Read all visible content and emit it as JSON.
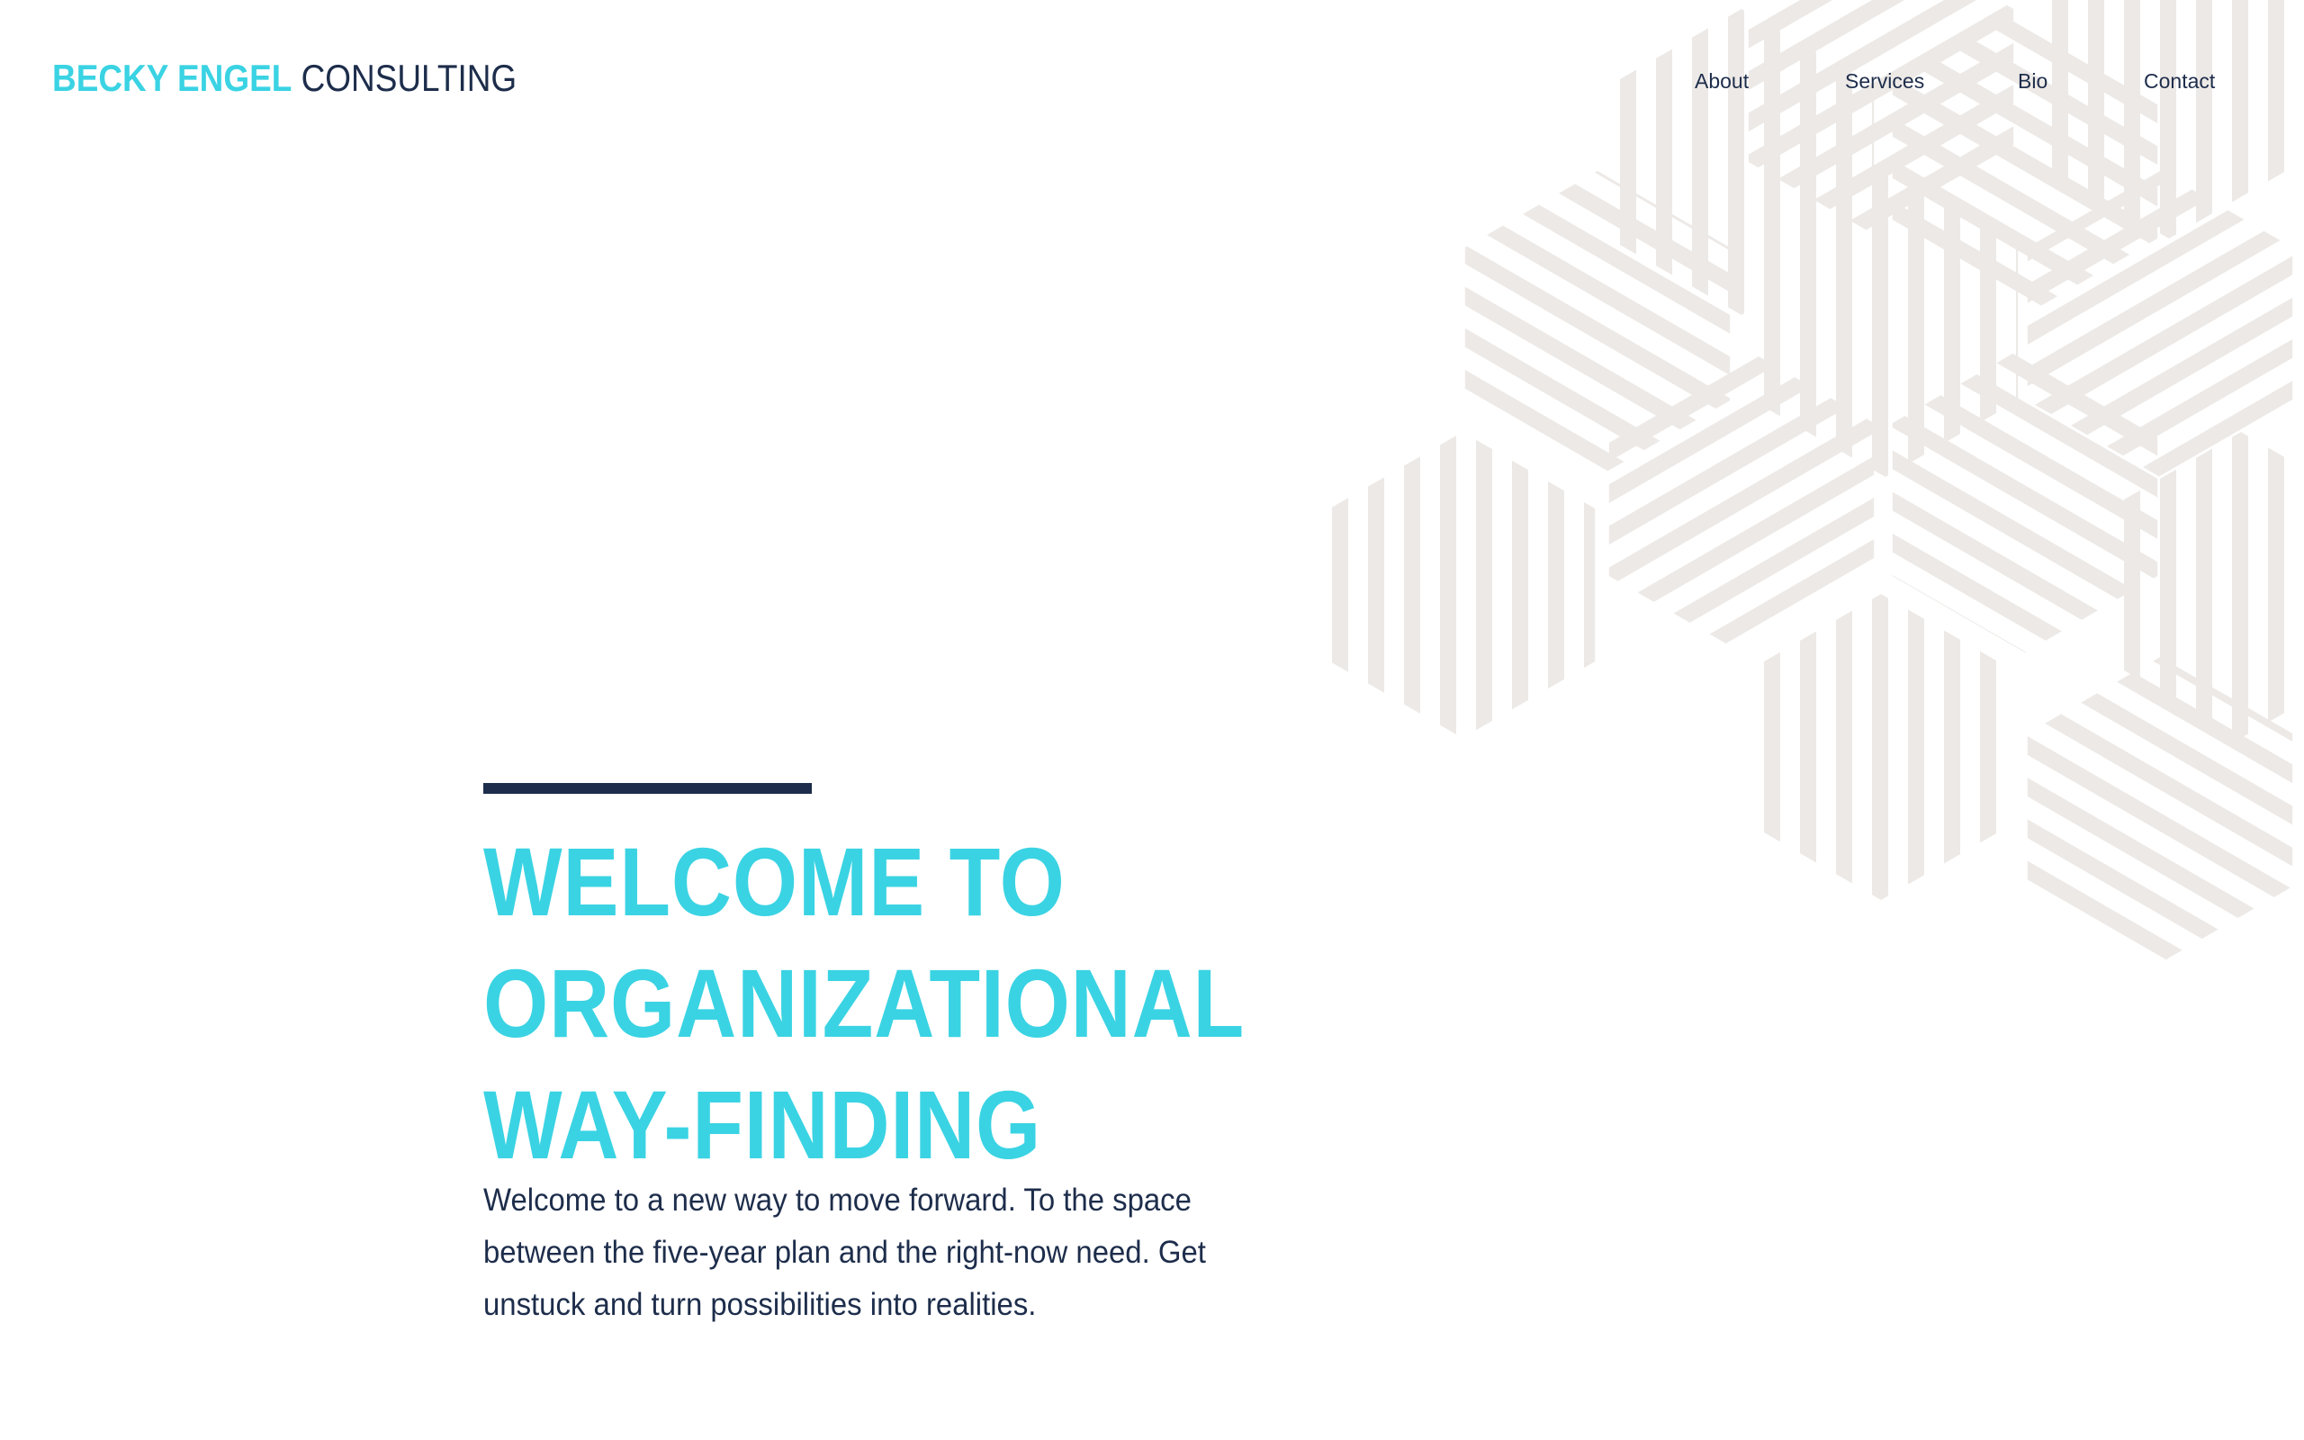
{
  "header": {
    "logo_bold": "BECKY ENGEL",
    "logo_light": "CONSULTING"
  },
  "nav": {
    "items": [
      {
        "label": "About"
      },
      {
        "label": "Services"
      },
      {
        "label": "Bio"
      },
      {
        "label": "Contact"
      }
    ]
  },
  "hero": {
    "title_lines": [
      "WELCOME TO",
      "ORGANIZATIONAL",
      "WAY-FINDING"
    ],
    "body": "Welcome to a new way to move forward. To the space between the five-year plan and the right-now need. Get unstuck and turn possibilities into realities."
  },
  "colors": {
    "accent": "#3ad3e3",
    "navy": "#1d2d4b",
    "pattern": "#ede9e6",
    "background": "#ffffff"
  }
}
